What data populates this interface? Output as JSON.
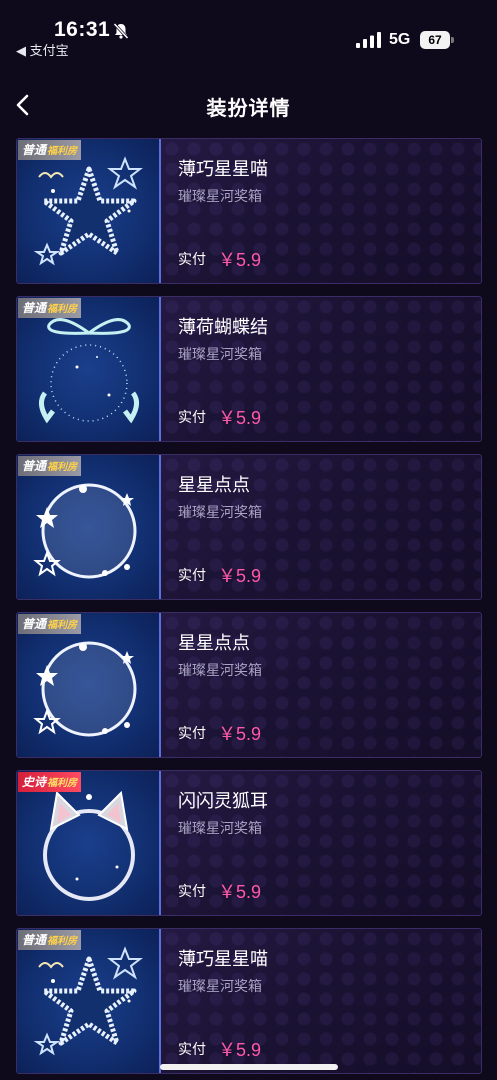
{
  "status_bar": {
    "time": "16:31",
    "back_app": "◀ 支付宝",
    "network": "5G",
    "battery": "67"
  },
  "header": {
    "title": "装扮详情"
  },
  "items": [
    {
      "badge": "普通",
      "badge_sub": "福利房",
      "badge_type": "normal",
      "art": "star",
      "name": "薄巧星星喵",
      "source": "璀璨星河奖箱",
      "paid_label": "实付",
      "price": "￥5.9"
    },
    {
      "badge": "普通",
      "badge_sub": "福利房",
      "badge_type": "normal",
      "art": "bow",
      "name": "薄荷蝴蝶结",
      "source": "璀璨星河奖箱",
      "paid_label": "实付",
      "price": "￥5.9"
    },
    {
      "badge": "普通",
      "badge_sub": "福利房",
      "badge_type": "normal",
      "art": "bubble",
      "name": "星星点点",
      "source": "璀璨星河奖箱",
      "paid_label": "实付",
      "price": "￥5.9"
    },
    {
      "badge": "普通",
      "badge_sub": "福利房",
      "badge_type": "normal",
      "art": "bubble",
      "name": "星星点点",
      "source": "璀璨星河奖箱",
      "paid_label": "实付",
      "price": "￥5.9"
    },
    {
      "badge": "史诗",
      "badge_sub": "福利房",
      "badge_type": "epic",
      "art": "fox",
      "name": "闪闪灵狐耳",
      "source": "璀璨星河奖箱",
      "paid_label": "实付",
      "price": "￥5.9"
    },
    {
      "badge": "普通",
      "badge_sub": "福利房",
      "badge_type": "normal",
      "art": "star",
      "name": "薄巧星星喵",
      "source": "璀璨星河奖箱",
      "paid_label": "实付",
      "price": "￥5.9"
    }
  ],
  "colors": {
    "background": "#0e0a1c",
    "price": "#ff58a8",
    "normal_badge": "#8a8a96",
    "epic_badge": "#e8263f"
  }
}
